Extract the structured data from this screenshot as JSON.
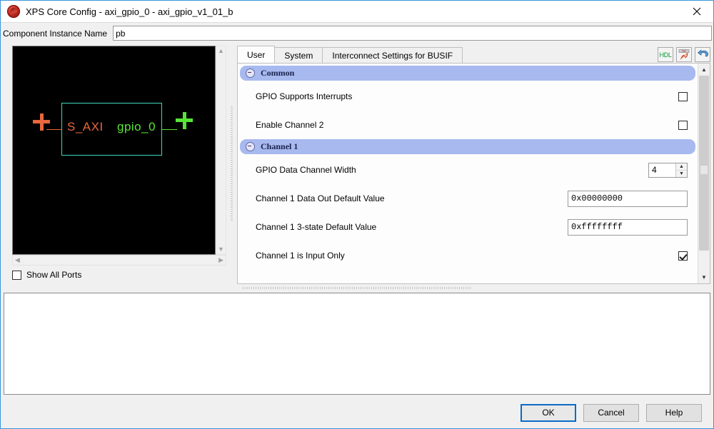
{
  "window": {
    "title": "XPS Core Config - axi_gpio_0 - axi_gpio_v1_01_b",
    "app_icon": "xps-logo-icon",
    "close_icon": "close-icon"
  },
  "instance": {
    "label": "Component Instance Name",
    "value": "pb",
    "placeholder": ""
  },
  "diagram": {
    "block_label_left": "S_AXI",
    "block_label_right": "gpio_0",
    "left_color": "#e8673c",
    "right_color": "#57e535",
    "block_border_color": "#3fd9c0",
    "background": "#000000",
    "scroll_up_icon": "chevron-up-icon",
    "scroll_down_icon": "chevron-down-icon",
    "scroll_left_icon": "chevron-left-icon",
    "scroll_right_icon": "chevron-right-icon"
  },
  "show_all_ports": {
    "label": "Show All Ports",
    "checked": false
  },
  "tabs": [
    {
      "label": "User",
      "active": true
    },
    {
      "label": "System",
      "active": false
    },
    {
      "label": "Interconnect Settings for BUSIF",
      "active": false
    }
  ],
  "tab_tools": [
    {
      "name": "hdl-view-icon",
      "label": "HDL"
    },
    {
      "name": "datasheet-pdf-icon",
      "label": ""
    },
    {
      "name": "restore-defaults-icon",
      "label": ""
    }
  ],
  "sections": [
    {
      "title": "Common",
      "collapse_icon": "collapse-minus-icon",
      "fields": [
        {
          "label": "GPIO Supports Interrupts",
          "type": "checkbox",
          "checked": false
        },
        {
          "label": "Enable Channel 2",
          "type": "checkbox",
          "checked": false
        }
      ]
    },
    {
      "title": "Channel 1",
      "collapse_icon": "collapse-minus-icon",
      "fields": [
        {
          "label": "GPIO Data Channel Width",
          "type": "spinner",
          "value": "4"
        },
        {
          "label": "Channel 1 Data Out Default Value",
          "type": "text",
          "value": "0x00000000"
        },
        {
          "label": "Channel 1 3-state Default Value",
          "type": "text",
          "value": "0xffffffff"
        },
        {
          "label": "Channel 1 is Input Only",
          "type": "checkbox",
          "checked": true
        }
      ]
    }
  ],
  "log": {
    "text": ""
  },
  "footer": {
    "ok": "OK",
    "cancel": "Cancel",
    "help": "Help"
  },
  "colors": {
    "accent": "#3a96dd",
    "section_header": "#a8b9ef",
    "default_button_border": "#0a6cc4"
  }
}
